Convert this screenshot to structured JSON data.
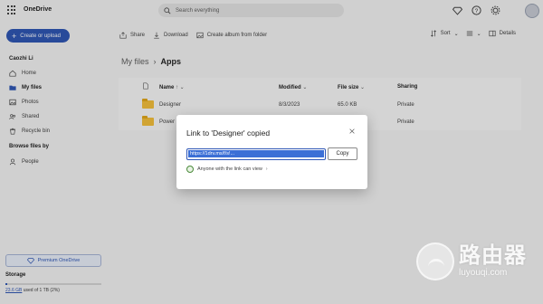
{
  "app": {
    "title": "OneDrive"
  },
  "search": {
    "placeholder": "Search everything"
  },
  "sidebar": {
    "create_label": "Create or upload",
    "user_name": "Caozhi Li",
    "items": [
      {
        "label": "Home",
        "icon": "home-icon"
      },
      {
        "label": "My files",
        "icon": "folder-icon"
      },
      {
        "label": "Photos",
        "icon": "photo-icon"
      },
      {
        "label": "Shared",
        "icon": "people-icon"
      },
      {
        "label": "Recycle bin",
        "icon": "trash-icon"
      }
    ],
    "browse_heading": "Browse files by",
    "people_label": "People",
    "premium_label": "Premium OneDrive",
    "storage_label": "Storage",
    "storage_used": "23.6 GB",
    "storage_rest": " used of 1 TB (2%)",
    "storage_fraction": 0.02
  },
  "toolbar": {
    "share": "Share",
    "download": "Download",
    "create_album": "Create album from folder",
    "sort": "Sort",
    "details": "Details"
  },
  "breadcrumb": {
    "parent": "My files",
    "current": "Apps"
  },
  "table": {
    "headers": {
      "name": "Name",
      "modified": "Modified",
      "size": "File size",
      "sharing": "Sharing"
    },
    "rows": [
      {
        "name": "Designer",
        "modified": "8/3/2023",
        "size": "65.0 KB",
        "sharing": "Private"
      },
      {
        "name": "Power",
        "modified": "",
        "size": "",
        "sharing": "Private"
      }
    ]
  },
  "dialog": {
    "title": "Link to 'Designer' copied",
    "link_value": "https://1drv.ms/f/s!...",
    "copy_label": "Copy",
    "permission": "Anyone with the link can view"
  },
  "watermark": {
    "cn": "路由器",
    "en": "luyouqi.com"
  },
  "colors": {
    "accent": "#2f57b6",
    "folder": "#f6c13c"
  }
}
